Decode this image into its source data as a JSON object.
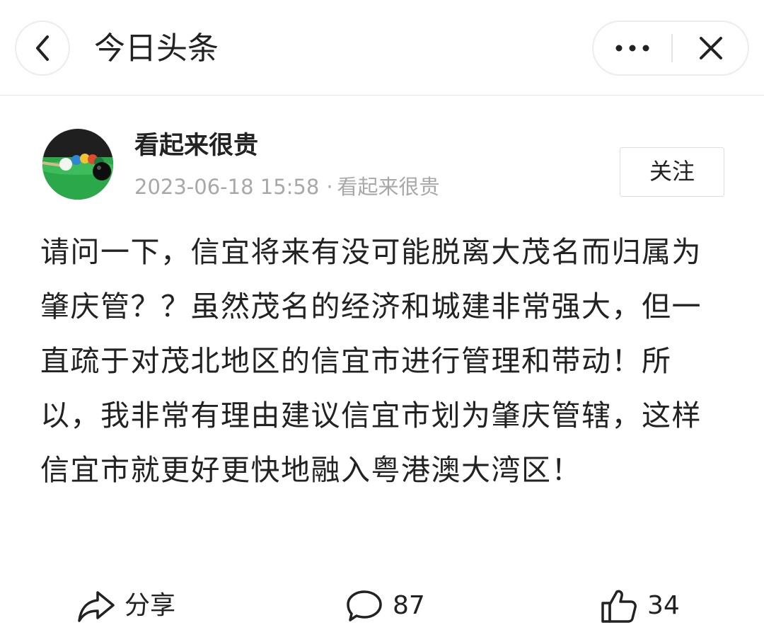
{
  "header": {
    "title": "今日头条",
    "back_icon": "chevron-left-icon",
    "more_icon": "more-dots-icon",
    "close_icon": "close-icon"
  },
  "author": {
    "name": "看起来很贵",
    "avatar_icon": "billiards-avatar",
    "timestamp": "2023-06-18 15:58",
    "separator": "·",
    "source": "看起来很贵",
    "follow_label": "关注"
  },
  "post": {
    "text": "请问一下，信宜将来有没可能脱离大茂名而归属为肇庆管？？虽然茂名的经济和城建非常强大，但一直疏于对茂北地区的信宜市进行管理和带动！所以，我非常有理由建议信宜市划为肇庆管辖，这样信宜市就更好更快地融入粤港澳大湾区！"
  },
  "actions": {
    "share": {
      "icon": "share-icon",
      "label": "分享"
    },
    "comment": {
      "icon": "comment-icon",
      "count": "87"
    },
    "like": {
      "icon": "thumbs-up-icon",
      "count": "34"
    }
  },
  "colors": {
    "text": "#222222",
    "meta": "#a8a8a8",
    "border": "#e6e6e6",
    "avatar_green": "#2aa84a"
  }
}
